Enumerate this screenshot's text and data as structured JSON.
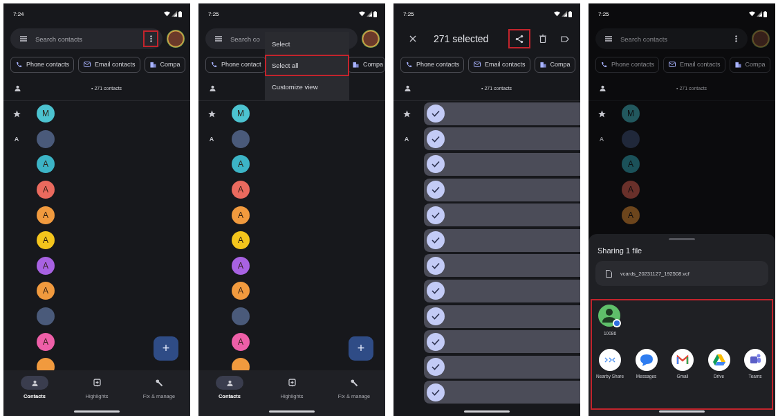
{
  "screens": [
    {
      "kind": "contacts",
      "status_time": "7:24",
      "search": {
        "placeholder": "Search contacts"
      },
      "more_button": {
        "highlighted": true
      },
      "chips": [
        {
          "label": "Phone contacts"
        },
        {
          "label": "Email contacts"
        },
        {
          "label": "Compa"
        }
      ],
      "count": "• 271 contacts",
      "rows": [
        {
          "section": {
            "kind": "star"
          },
          "selected": false,
          "avatar": {
            "kind": "letter",
            "letter": "M",
            "color": "#4cc3d0"
          }
        },
        {
          "section": {
            "kind": "letter",
            "label": "A"
          },
          "selected": false,
          "avatar": {
            "kind": "photo"
          }
        },
        {
          "selected": false,
          "avatar": {
            "kind": "letter",
            "letter": "A",
            "color": "#3cb4c6"
          }
        },
        {
          "selected": false,
          "avatar": {
            "kind": "letter",
            "letter": "A",
            "color": "#ea6a5e"
          }
        },
        {
          "selected": false,
          "avatar": {
            "kind": "letter",
            "letter": "A",
            "color": "#f19a3e"
          }
        },
        {
          "selected": false,
          "avatar": {
            "kind": "letter",
            "letter": "A",
            "color": "#f4c51c"
          }
        },
        {
          "selected": false,
          "avatar": {
            "kind": "letter",
            "letter": "A",
            "color": "#a862e2"
          }
        },
        {
          "selected": false,
          "avatar": {
            "kind": "letter",
            "letter": "A",
            "color": "#f19a3e"
          }
        },
        {
          "selected": false,
          "avatar": {
            "kind": "photo"
          }
        },
        {
          "selected": false,
          "avatar": {
            "kind": "letter",
            "letter": "A",
            "color": "#ee5fa8"
          }
        },
        {
          "selected": false,
          "avatar": {
            "kind": "letter",
            "color": "#f19a3e"
          }
        }
      ],
      "fab": {
        "label": "+"
      },
      "nav": [
        {
          "label": "Contacts",
          "selected": true
        },
        {
          "label": "Highlights",
          "selected": false
        },
        {
          "label": "Fix & manage",
          "selected": false
        }
      ]
    },
    {
      "kind": "contacts",
      "status_time": "7:25",
      "search": {
        "placeholder": "Search co"
      },
      "chips": [
        {
          "label": "Phone contact"
        },
        {
          "label": "Compa"
        }
      ],
      "rows": [
        {
          "section": {
            "kind": "star"
          },
          "selected": false,
          "avatar": {
            "kind": "letter",
            "letter": "M",
            "color": "#4cc3d0"
          }
        },
        {
          "section": {
            "kind": "letter",
            "label": "A"
          },
          "selected": false,
          "avatar": {
            "kind": "photo"
          }
        },
        {
          "selected": false,
          "avatar": {
            "kind": "letter",
            "letter": "A",
            "color": "#3cb4c6"
          }
        },
        {
          "selected": false,
          "avatar": {
            "kind": "letter",
            "letter": "A",
            "color": "#ea6a5e"
          }
        },
        {
          "selected": false,
          "avatar": {
            "kind": "letter",
            "letter": "A",
            "color": "#f19a3e"
          }
        },
        {
          "selected": false,
          "avatar": {
            "kind": "letter",
            "letter": "A",
            "color": "#f4c51c"
          }
        },
        {
          "selected": false,
          "avatar": {
            "kind": "letter",
            "letter": "A",
            "color": "#a862e2"
          }
        },
        {
          "selected": false,
          "avatar": {
            "kind": "letter",
            "letter": "A",
            "color": "#f19a3e"
          }
        },
        {
          "selected": false,
          "avatar": {
            "kind": "photo"
          }
        },
        {
          "selected": false,
          "avatar": {
            "kind": "letter",
            "letter": "A",
            "color": "#ee5fa8"
          }
        },
        {
          "selected": false,
          "avatar": {
            "kind": "letter",
            "color": "#f19a3e"
          }
        }
      ],
      "fab": {
        "label": "+"
      },
      "nav": [
        {
          "label": "Contacts",
          "selected": true
        },
        {
          "label": "Highlights",
          "selected": false
        },
        {
          "label": "Fix & manage",
          "selected": false
        }
      ],
      "menu": [
        {
          "label": "Select",
          "highlighted": false
        },
        {
          "label": "Select all",
          "highlighted": true
        },
        {
          "label": "Customize view",
          "highlighted": false
        }
      ]
    },
    {
      "kind": "selection",
      "status_time": "7:25",
      "title": "271 selected",
      "share_button": {
        "highlighted": true
      },
      "chips": [
        {
          "label": "Phone contacts"
        },
        {
          "label": "Email contacts"
        },
        {
          "label": "Compa"
        }
      ],
      "count": "• 271 contacts",
      "rows": [
        {
          "section": {
            "kind": "star"
          },
          "selected": true
        },
        {
          "section": {
            "kind": "letter",
            "label": "A"
          },
          "selected": true
        },
        {
          "selected": true
        },
        {
          "selected": true
        },
        {
          "selected": true
        },
        {
          "selected": true
        },
        {
          "selected": true
        },
        {
          "selected": true
        },
        {
          "selected": true
        },
        {
          "selected": true
        },
        {
          "selected": true
        },
        {
          "selected": true
        }
      ]
    },
    {
      "kind": "contacts",
      "status_time": "7:25",
      "dimmed": true,
      "search": {
        "placeholder": "Search contacts"
      },
      "more_button": {
        "highlighted": false
      },
      "chips": [
        {
          "label": "Phone contacts"
        },
        {
          "label": "Email contacts"
        },
        {
          "label": "Compa"
        }
      ],
      "count": "• 271 contacts",
      "rows": [
        {
          "section": {
            "kind": "star"
          },
          "selected": false,
          "avatar": {
            "kind": "letter",
            "letter": "M",
            "color": "#22585e"
          }
        },
        {
          "section": {
            "kind": "letter",
            "label": "A"
          },
          "selected": false,
          "avatar": {
            "kind": "photo"
          }
        },
        {
          "selected": false,
          "avatar": {
            "kind": "letter",
            "letter": "A",
            "color": "#1b5159"
          }
        },
        {
          "selected": false,
          "avatar": {
            "kind": "letter",
            "letter": "A",
            "color": "#69302a"
          }
        },
        {
          "selected": false,
          "avatar": {
            "kind": "letter",
            "letter": "A",
            "color": "#6c451c"
          }
        }
      ],
      "sheet": {
        "title": "Sharing 1 file",
        "file_name": "vcards_20231127_192508.vcf",
        "targets_highlighted": true,
        "contacts": [
          {
            "name": "10086"
          }
        ],
        "apps": [
          {
            "name": "Nearby Share"
          },
          {
            "name": "Messages"
          },
          {
            "name": "Gmail"
          },
          {
            "name": "Drive"
          },
          {
            "name": "Teams"
          }
        ]
      }
    }
  ]
}
